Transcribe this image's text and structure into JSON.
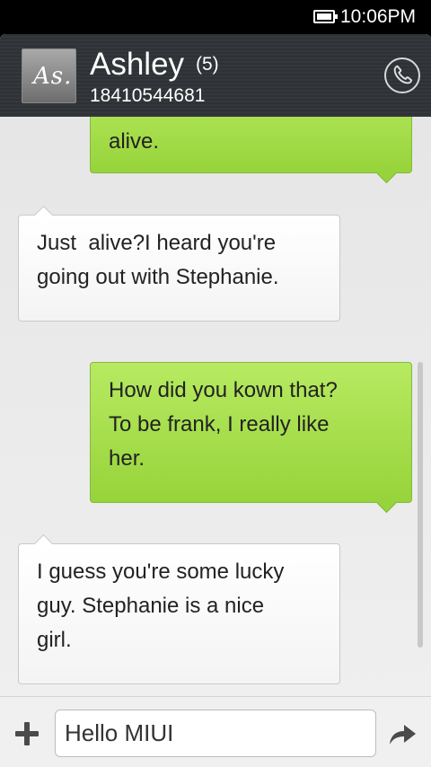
{
  "status_bar": {
    "time": "10:06PM",
    "battery_icon": "battery-full-icon"
  },
  "header": {
    "avatar_text": "As.",
    "contact_name": "Ashley",
    "message_count": "(5)",
    "contact_number": "18410544681",
    "call_icon": "phone-icon"
  },
  "messages": [
    {
      "type": "sent",
      "lines": [
        "alive."
      ]
    },
    {
      "type": "received",
      "lines": [
        "Just  alive?I heard you're",
        "going out with Stephanie."
      ]
    },
    {
      "type": "sent",
      "lines": [
        "How did you kown that?",
        "To be frank, I really like",
        "her."
      ]
    },
    {
      "type": "received",
      "lines": [
        "I guess you're some lucky",
        "guy. Stephanie is a nice",
        "girl."
      ]
    }
  ],
  "composer": {
    "value": "Hello MIUI",
    "add_icon": "plus-icon",
    "send_icon": "send-arrow-icon"
  },
  "colors": {
    "header_bg": "#2e3135",
    "sent_bubble": "#a8df4e",
    "received_bubble": "#ffffff",
    "conversation_bg": "#ebebeb"
  }
}
